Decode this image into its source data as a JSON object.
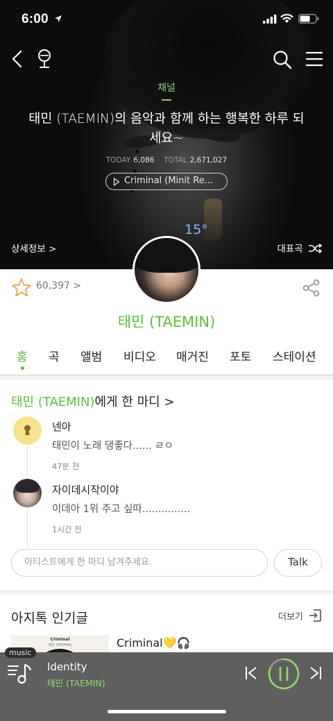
{
  "status_bar": {
    "time": "6:00"
  },
  "hero": {
    "channel_label": "채널",
    "title": "태민 (TAEMIN)의 음악과 함께 하는 행복한 하루 되세요~",
    "stats": {
      "today_label": "TODAY",
      "today": "6,086",
      "total_label": "TOTAL",
      "total": "2,671,027"
    },
    "now_playing_pill": "Criminal (Minit Re...",
    "detail_link": "상세정보 >",
    "top_tracks": "대표곡",
    "temperature": "15°"
  },
  "profile": {
    "fan_count": "60,397 >",
    "artist_name": "태민 (TAEMIN)"
  },
  "tabs": [
    "홈",
    "곡",
    "앨범",
    "비디오",
    "매거진",
    "포토",
    "스테이션"
  ],
  "one_word": {
    "title_name": "태민 (TAEMIN)",
    "title_suffix": "에게 한 마디 >",
    "comments": [
      {
        "user": "넨아",
        "text": "태민이 노래 댕좋다...... ㄹㅇ",
        "time": "47분 전"
      },
      {
        "user": "자이데시작이야",
        "text": "이데아 1위 주고 싶따...............",
        "time": "1시간 전"
      }
    ],
    "input_placeholder": "아티스트에게 한 마디 남겨주세요.",
    "talk_button": "Talk"
  },
  "popular": {
    "title": "아지톡 인기글",
    "more": "더보기",
    "post_title": "Criminal💛🎧",
    "thumb_title": "Criminal",
    "thumb_sub": "태민 (TAEMIN)"
  },
  "player": {
    "tag": "music",
    "track": "Identity",
    "artist": "태민 (TAEMIN)"
  },
  "colors": {
    "accent": "#5cbf3e",
    "player_bg": "#5f5f5f",
    "temperature": "#88b5ff"
  }
}
